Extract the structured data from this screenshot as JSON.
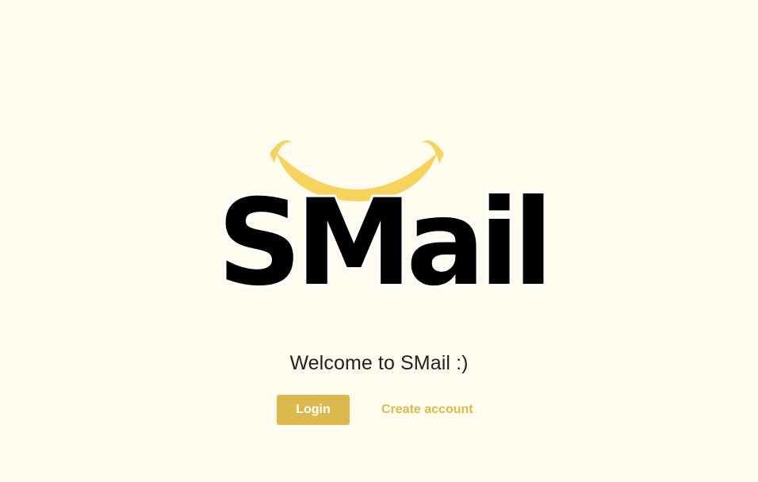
{
  "logo": {
    "text": "SMail",
    "smile_color": "#f5d35c",
    "text_color": "#000000"
  },
  "welcome": {
    "text": "Welcome to SMail :)"
  },
  "actions": {
    "login_label": "Login",
    "create_label": "Create account",
    "accent_color": "#dbb94c"
  },
  "background_color": "#fffcef"
}
